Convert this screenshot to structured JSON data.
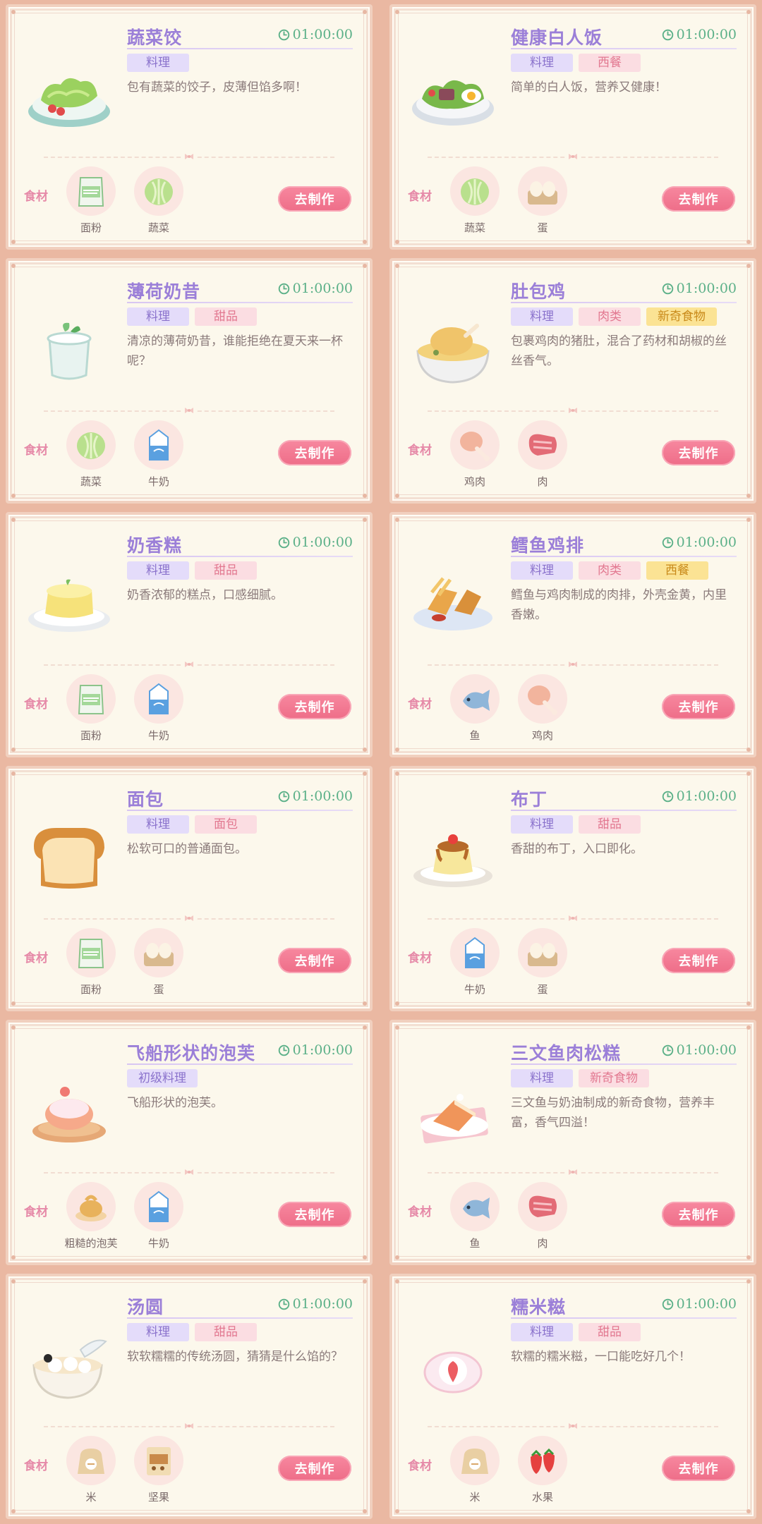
{
  "ingredient_label": "食材",
  "make_button_label": "去制作",
  "recipes": [
    {
      "title": "蔬菜饺",
      "time": "01:00:00",
      "dish_icon": "salad-plate",
      "tags": [
        {
          "text": "料理",
          "color": "purple"
        }
      ],
      "desc": "包有蔬菜的饺子，皮薄但馅多啊！",
      "ingredients": [
        {
          "name": "面粉",
          "icon": "flour"
        },
        {
          "name": "蔬菜",
          "icon": "cabbage"
        }
      ]
    },
    {
      "title": "健康白人饭",
      "time": "01:00:00",
      "dish_icon": "salad-egg-plate",
      "tags": [
        {
          "text": "料理",
          "color": "purple"
        },
        {
          "text": "西餐",
          "color": "pink"
        }
      ],
      "desc": "简单的白人饭，营养又健康！",
      "ingredients": [
        {
          "name": "蔬菜",
          "icon": "cabbage"
        },
        {
          "name": "蛋",
          "icon": "eggs"
        }
      ]
    },
    {
      "title": "薄荷奶昔",
      "time": "01:00:00",
      "dish_icon": "mint-shake",
      "tags": [
        {
          "text": "料理",
          "color": "purple"
        },
        {
          "text": "甜品",
          "color": "pink"
        }
      ],
      "desc": "清凉的薄荷奶昔，谁能拒绝在夏天来一杯呢？",
      "ingredients": [
        {
          "name": "蔬菜",
          "icon": "cabbage"
        },
        {
          "name": "牛奶",
          "icon": "milk"
        }
      ]
    },
    {
      "title": "肚包鸡",
      "time": "01:00:00",
      "dish_icon": "chicken-soup",
      "tags": [
        {
          "text": "料理",
          "color": "purple"
        },
        {
          "text": "肉类",
          "color": "pink"
        },
        {
          "text": "新奇食物",
          "color": "yellow"
        }
      ],
      "desc": "包裹鸡肉的猪肚，混合了药材和胡椒的丝丝香气。",
      "ingredients": [
        {
          "name": "鸡肉",
          "icon": "drumstick"
        },
        {
          "name": "肉",
          "icon": "meat"
        }
      ]
    },
    {
      "title": "奶香糕",
      "time": "01:00:00",
      "dish_icon": "milk-cake",
      "tags": [
        {
          "text": "料理",
          "color": "purple"
        },
        {
          "text": "甜品",
          "color": "pink"
        }
      ],
      "desc": "奶香浓郁的糕点，口感细腻。",
      "ingredients": [
        {
          "name": "面粉",
          "icon": "flour"
        },
        {
          "name": "牛奶",
          "icon": "milk"
        }
      ]
    },
    {
      "title": "鳕鱼鸡排",
      "time": "01:00:00",
      "dish_icon": "fish-cutlet",
      "tags": [
        {
          "text": "料理",
          "color": "purple"
        },
        {
          "text": "肉类",
          "color": "pink"
        },
        {
          "text": "西餐",
          "color": "yellow"
        }
      ],
      "desc": "鳕鱼与鸡肉制成的肉排，外壳金黄，内里香嫩。",
      "ingredients": [
        {
          "name": "鱼",
          "icon": "fish"
        },
        {
          "name": "鸡肉",
          "icon": "drumstick"
        }
      ]
    },
    {
      "title": "面包",
      "time": "01:00:00",
      "dish_icon": "bread-loaf",
      "tags": [
        {
          "text": "料理",
          "color": "purple"
        },
        {
          "text": "面包",
          "color": "pink"
        }
      ],
      "desc": "松软可口的普通面包。",
      "ingredients": [
        {
          "name": "面粉",
          "icon": "flour"
        },
        {
          "name": "蛋",
          "icon": "eggs"
        }
      ]
    },
    {
      "title": "布丁",
      "time": "01:00:00",
      "dish_icon": "pudding",
      "tags": [
        {
          "text": "料理",
          "color": "purple"
        },
        {
          "text": "甜品",
          "color": "pink"
        }
      ],
      "desc": "香甜的布丁，入口即化。",
      "ingredients": [
        {
          "name": "牛奶",
          "icon": "milk"
        },
        {
          "name": "蛋",
          "icon": "eggs"
        }
      ]
    },
    {
      "title": "飞船形状的泡芙",
      "time": "01:00:00",
      "dish_icon": "puff",
      "tags": [
        {
          "text": "初级料理",
          "color": "purple"
        }
      ],
      "desc": "飞船形状的泡芙。",
      "ingredients": [
        {
          "name": "粗糙的泡芙",
          "icon": "rough-puff"
        },
        {
          "name": "牛奶",
          "icon": "milk"
        }
      ]
    },
    {
      "title": "三文鱼肉松糕",
      "time": "01:00:00",
      "dish_icon": "salmon-cake",
      "tags": [
        {
          "text": "料理",
          "color": "purple"
        },
        {
          "text": "新奇食物",
          "color": "pink"
        }
      ],
      "desc": "三文鱼与奶油制成的新奇食物，营养丰富，香气四溢！",
      "ingredients": [
        {
          "name": "鱼",
          "icon": "fish"
        },
        {
          "name": "肉",
          "icon": "meat"
        }
      ]
    },
    {
      "title": "汤圆",
      "time": "01:00:00",
      "dish_icon": "tangyuan-bowl",
      "tags": [
        {
          "text": "料理",
          "color": "purple"
        },
        {
          "text": "甜品",
          "color": "pink"
        }
      ],
      "desc": "软软糯糯的传统汤圆，猜猜是什么馅的？",
      "ingredients": [
        {
          "name": "米",
          "icon": "rice-sack"
        },
        {
          "name": "坚果",
          "icon": "nut-bag"
        }
      ]
    },
    {
      "title": "糯米糍",
      "time": "01:00:00",
      "dish_icon": "mochi",
      "tags": [
        {
          "text": "料理",
          "color": "purple"
        },
        {
          "text": "甜品",
          "color": "pink"
        }
      ],
      "desc": "软糯的糯米糍，一口能吃好几个！",
      "ingredients": [
        {
          "name": "米",
          "icon": "rice-sack"
        },
        {
          "name": "水果",
          "icon": "strawberries"
        }
      ]
    }
  ]
}
